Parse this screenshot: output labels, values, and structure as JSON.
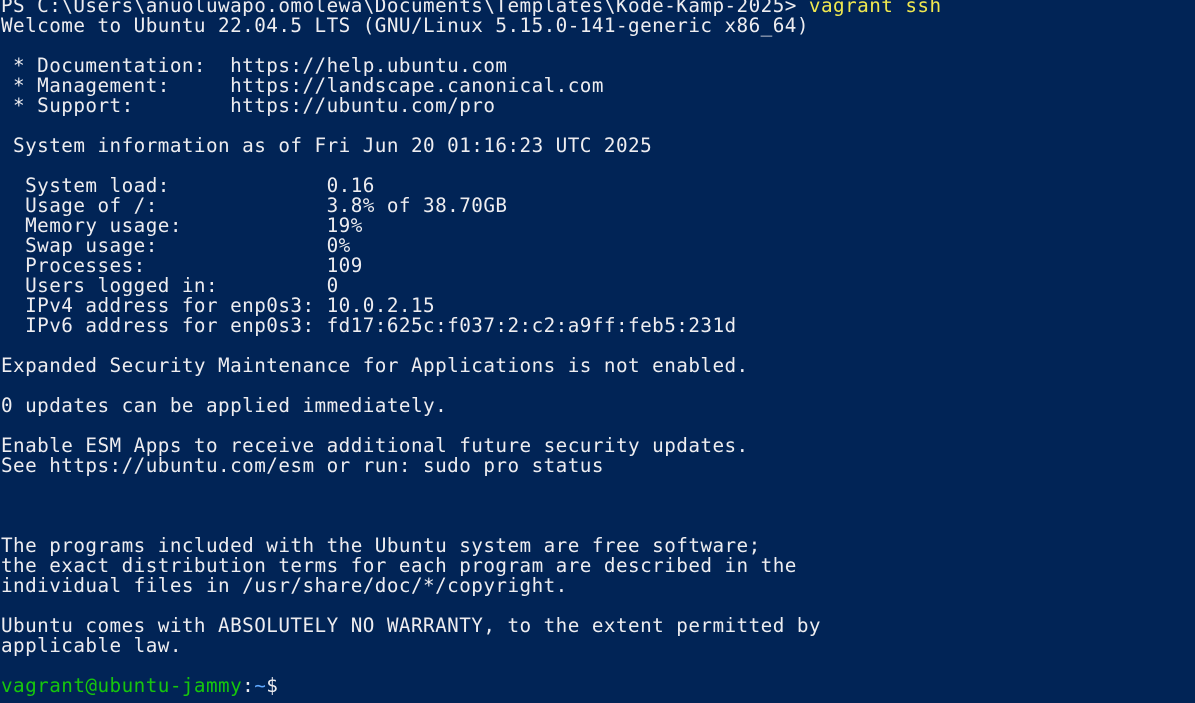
{
  "colors": {
    "background": "#012456",
    "foreground": "#eeedf0",
    "command": "#f0e84f",
    "prompt_user": "#16c60c",
    "prompt_path": "#5fa8ff"
  },
  "session": {
    "ps_prompt": "PS C:\\Users\\anuoluwapo.omolewa\\Documents\\Templates\\Kode-Kamp-2025> ",
    "ps_command": "vagrant ssh",
    "welcome": "Welcome to Ubuntu 22.04.5 LTS (GNU/Linux 5.15.0-141-generic x86_64)"
  },
  "links": [
    " * Documentation:  https://help.ubuntu.com",
    " * Management:     https://landscape.canonical.com",
    " * Support:        https://ubuntu.com/pro"
  ],
  "sysinfo": {
    "heading": " System information as of Fri Jun 20 01:16:23 UTC 2025",
    "rows": [
      "  System load:             0.16",
      "  Usage of /:              3.8% of 38.70GB",
      "  Memory usage:            19%",
      "  Swap usage:              0%",
      "  Processes:               109",
      "  Users logged in:         0",
      "  IPv4 address for enp0s3: 10.0.2.15",
      "  IPv6 address for enp0s3: fd17:625c:f037:2:c2:a9ff:feb5:231d"
    ]
  },
  "messages": {
    "esm": "Expanded Security Maintenance for Applications is not enabled.",
    "updates": "0 updates can be applied immediately.",
    "esm_apps_1": "Enable ESM Apps to receive additional future security updates.",
    "esm_apps_2": "See https://ubuntu.com/esm or run: sudo pro status",
    "programs_1": "The programs included with the Ubuntu system are free software;",
    "programs_2": "the exact distribution terms for each program are described in the",
    "programs_3": "individual files in /usr/share/doc/*/copyright.",
    "warranty_1": "Ubuntu comes with ABSOLUTELY NO WARRANTY, to the extent permitted by",
    "warranty_2": "applicable law."
  },
  "shell_prompt": {
    "user_host": "vagrant@ubuntu-jammy",
    "colon": ":",
    "path": "~",
    "symbol": "$ "
  }
}
